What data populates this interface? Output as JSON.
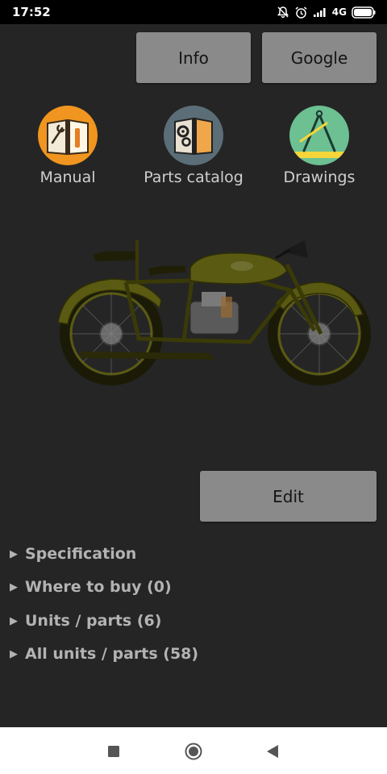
{
  "status": {
    "time": "17:52",
    "network": "4G"
  },
  "actions": {
    "info_label": "Info",
    "google_label": "Google",
    "edit_label": "Edit"
  },
  "shortcuts": [
    {
      "label": "Manual",
      "icon": "manual-book-wrench-icon",
      "bg": "#f0951f"
    },
    {
      "label": "Parts catalog",
      "icon": "parts-catalog-gears-icon",
      "bg": "#5b6e78"
    },
    {
      "label": "Drawings",
      "icon": "drawing-compass-icon",
      "bg": "#6cc092"
    }
  ],
  "sections": [
    {
      "label": "Specification"
    },
    {
      "label": "Where to buy (0)"
    },
    {
      "label": "Units / parts (6)"
    },
    {
      "label": "All units / parts (58)"
    }
  ],
  "colors": {
    "background": "#252525",
    "button": "#8a8a8a",
    "section_text": "#b3b3b3",
    "motorcycle": "#5a5a12"
  },
  "nav": {
    "icons": [
      "recent-apps-square-icon",
      "home-circle-icon",
      "back-triangle-icon"
    ]
  }
}
